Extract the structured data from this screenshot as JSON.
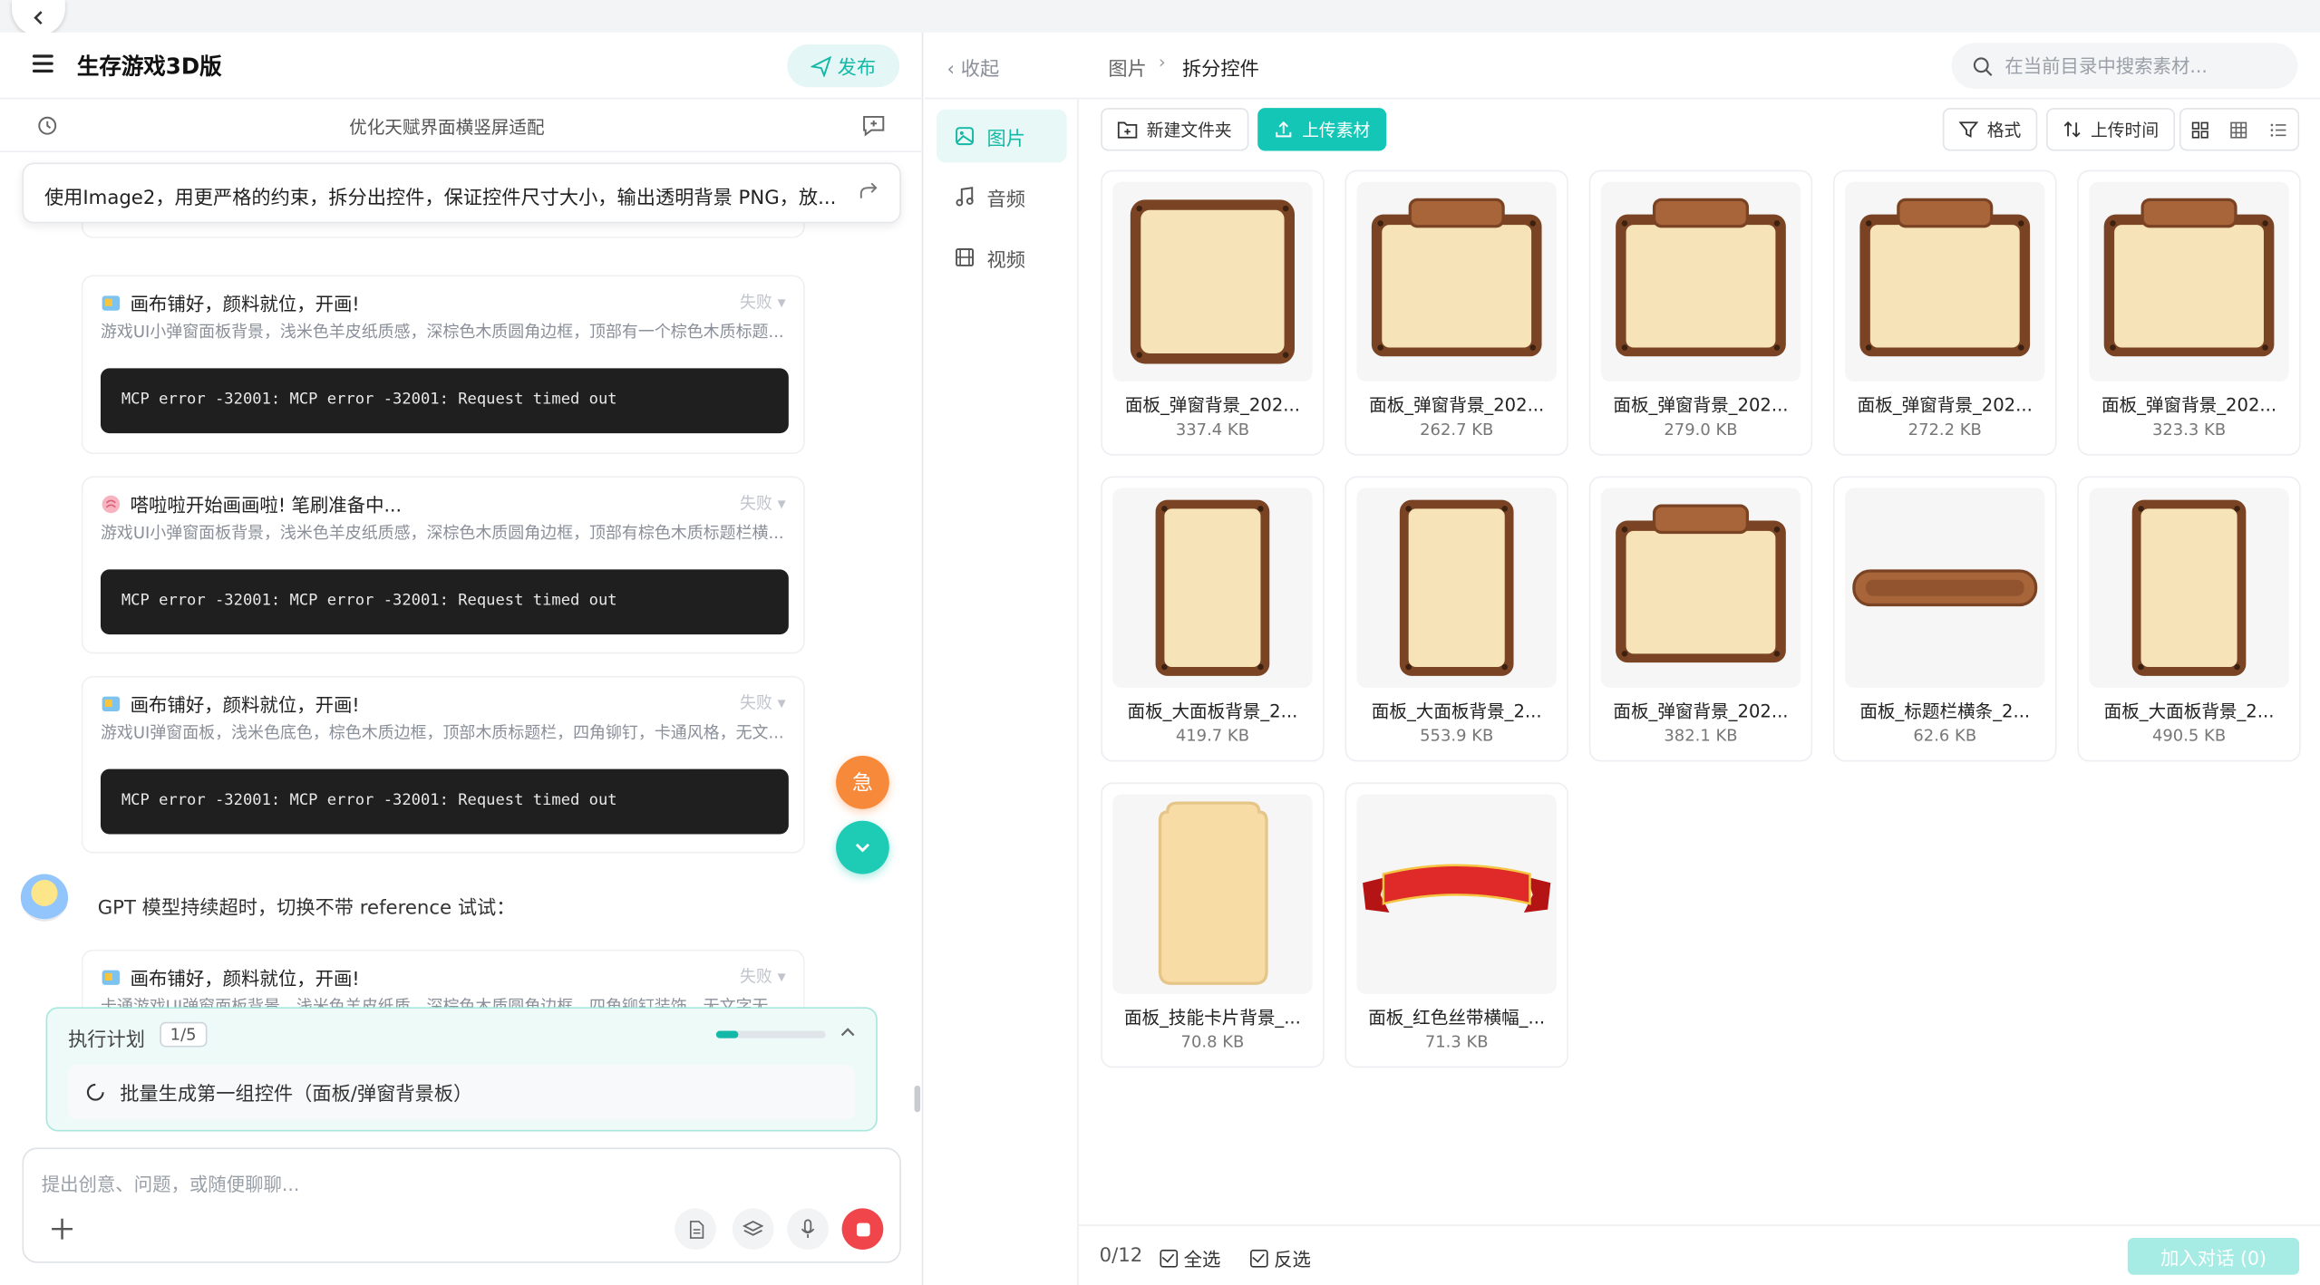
{
  "app": {
    "title": "生存游戏3D版",
    "publish_label": "发布",
    "subtitle": "优化天赋界面横竖屏适配"
  },
  "prompt_text": "使用Image2，用更严格的约束，拆分出控件，保证控件尺寸大小，输出透明背景 PNG，放...",
  "tasks": [
    {
      "title": "画布铺好，颜料就位，开画!",
      "status": "失败",
      "desc": "游戏UI小弹窗面板背景，浅米色羊皮纸质感，深棕色木质圆角边框，顶部有一个棕色木质标题...",
      "error": "MCP error -32001: MCP error -32001: Request timed out"
    },
    {
      "title": "嗒啦啦开始画画啦! 笔刷准备中...",
      "status": "失败",
      "desc": "游戏UI小弹窗面板背景，浅米色羊皮纸质感，深棕色木质圆角边框，顶部有棕色木质标题栏横...",
      "error": "MCP error -32001: MCP error -32001: Request timed out"
    },
    {
      "title": "画布铺好，颜料就位，开画!",
      "status": "失败",
      "desc": "游戏UI弹窗面板，浅米色底色，棕色木质边框，顶部木质标题栏，四角铆钉，卡通风格，无文...",
      "error": "MCP error -32001: MCP error -32001: Request timed out"
    },
    {
      "title": "画布铺好，颜料就位，开画!",
      "status": "失败",
      "desc": "卡通游戏UI弹窗面板背景，浅米色羊皮纸质，深棕色木质圆角边框，四角铆钉装饰，无文字无..."
    }
  ],
  "gpt_message": "GPT 模型持续超时，切换不带 reference 试试：",
  "bug_label": "急",
  "plan": {
    "label": "执行计划",
    "count": "1/5",
    "progress": 0.2,
    "item": "批量生成第一组控件（面板/弹窗背景板）"
  },
  "input_placeholder": "提出创意、问题，或随便聊聊...",
  "right": {
    "collapse_label": "收起",
    "breadcrumb": [
      "图片",
      "拆分控件"
    ],
    "search_placeholder": "在当前目录中搜索素材...",
    "sidebar": [
      "图片",
      "音频",
      "视频"
    ],
    "toolbar": {
      "new_folder": "新建文件夹",
      "upload": "上传素材",
      "format": "格式",
      "upload_time": "上传时间"
    },
    "files": [
      {
        "name": "面板_弹窗背景_202...",
        "size": "337.4 KB",
        "kind": "square"
      },
      {
        "name": "面板_弹窗背景_202...",
        "size": "262.7 KB",
        "kind": "wide-header"
      },
      {
        "name": "面板_弹窗背景_202...",
        "size": "279.0 KB",
        "kind": "wide-header"
      },
      {
        "name": "面板_弹窗背景_202...",
        "size": "272.2 KB",
        "kind": "wide-header"
      },
      {
        "name": "面板_弹窗背景_202...",
        "size": "323.3 KB",
        "kind": "wide-header"
      },
      {
        "name": "面板_大面板背景_2...",
        "size": "419.7 KB",
        "kind": "tall"
      },
      {
        "name": "面板_大面板背景_2...",
        "size": "553.9 KB",
        "kind": "tall"
      },
      {
        "name": "面板_弹窗背景_202...",
        "size": "382.1 KB",
        "kind": "wide-header"
      },
      {
        "name": "面板_标题栏横条_2...",
        "size": "62.6 KB",
        "kind": "bar"
      },
      {
        "name": "面板_大面板背景_2...",
        "size": "490.5 KB",
        "kind": "tall"
      },
      {
        "name": "面板_技能卡片背景_...",
        "size": "70.8 KB",
        "kind": "card"
      },
      {
        "name": "面板_红色丝带横幅_...",
        "size": "71.3 KB",
        "kind": "ribbon"
      }
    ],
    "footer": {
      "count": "0/12",
      "select_all": "全选",
      "invert": "反选",
      "add_to_chat": "加入对话 (0)"
    }
  }
}
